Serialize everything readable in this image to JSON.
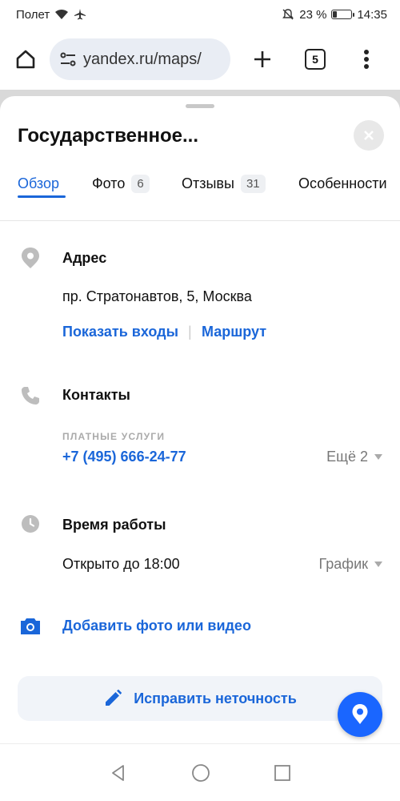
{
  "status_bar": {
    "carrier": "Полет",
    "battery": "23 %",
    "battery_level": 0.23,
    "time": "14:35"
  },
  "browser": {
    "url": "yandex.ru/maps/",
    "tab_count": "5"
  },
  "place": {
    "title": "Государственное..."
  },
  "tabs": [
    {
      "label": "Обзор",
      "badge": "",
      "active": true
    },
    {
      "label": "Фото",
      "badge": "6",
      "active": false
    },
    {
      "label": "Отзывы",
      "badge": "31",
      "active": false
    },
    {
      "label": "Особенности",
      "badge": "",
      "active": false
    }
  ],
  "address": {
    "title": "Адрес",
    "value": "пр. Стратонавтов, 5, Москва",
    "show_entrances": "Показать входы",
    "route": "Маршрут"
  },
  "contacts": {
    "title": "Контакты",
    "caption": "ПЛАТНЫЕ УСЛУГИ",
    "phone": "+7 (495) 666-24-77",
    "more": "Ещё 2"
  },
  "hours": {
    "title": "Время работы",
    "status": "Открыто до 18:00",
    "schedule": "График"
  },
  "add_media": "Добавить фото или видео",
  "fix_button": "Исправить неточность",
  "colors": {
    "accent": "#1a66d9",
    "fab": "#1a66ff"
  }
}
